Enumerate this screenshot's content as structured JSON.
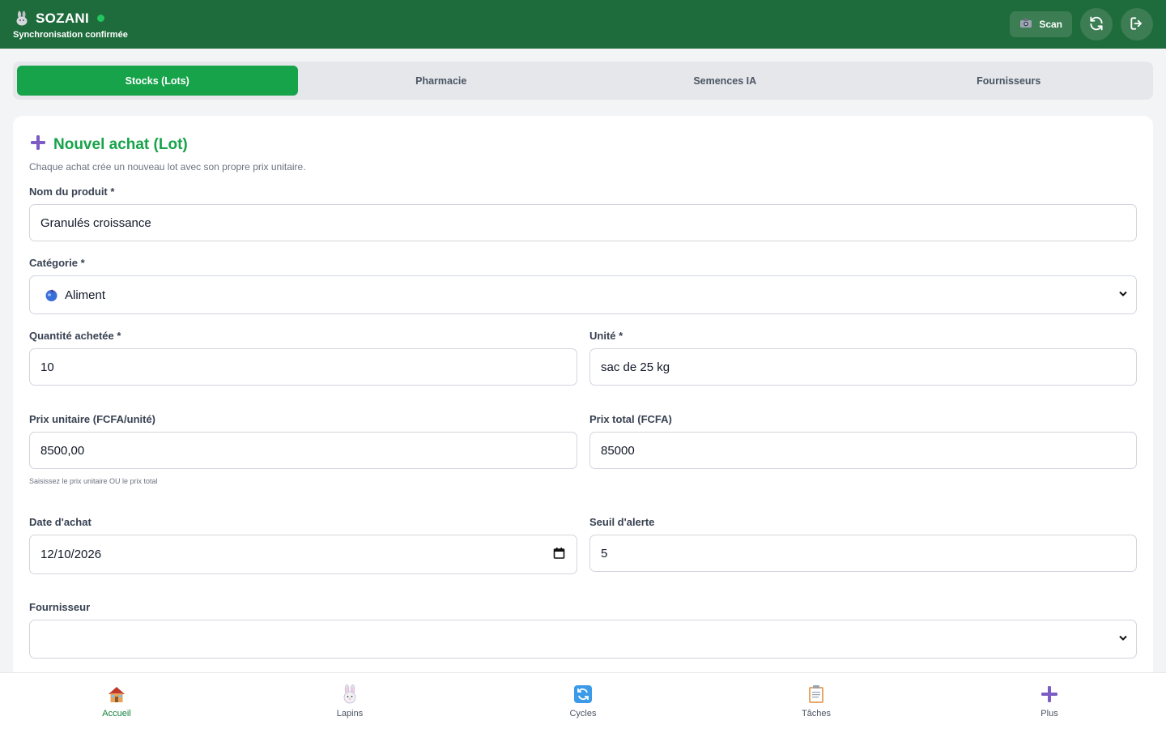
{
  "header": {
    "brand": "SOZANI",
    "sync_status": "Synchronisation confirmée",
    "scan_label": "Scan"
  },
  "tabs": [
    {
      "label": "Stocks (Lots)",
      "active": true
    },
    {
      "label": "Pharmacie",
      "active": false
    },
    {
      "label": "Semences IA",
      "active": false
    },
    {
      "label": "Fournisseurs",
      "active": false
    }
  ],
  "form": {
    "title": "Nouvel achat (Lot)",
    "subtitle": "Chaque achat crée un nouveau lot avec son propre prix unitaire.",
    "product_label": "Nom du produit *",
    "product_value": "Granulés croissance",
    "category_label": "Catégorie *",
    "category_value": "Aliment",
    "quantity_label": "Quantité achetée *",
    "quantity_value": "10",
    "unit_label": "Unité *",
    "unit_value": "sac de 25 kg",
    "unit_price_label": "Prix unitaire (FCFA/unité)",
    "unit_price_value": "8500,00",
    "total_price_label": "Prix total (FCFA)",
    "total_price_value": "85000",
    "price_hint": "Saisissez le prix unitaire OU le prix total",
    "date_label": "Date d'achat",
    "date_value": "12/10/2026",
    "threshold_label": "Seuil d'alerte",
    "threshold_value": "5",
    "supplier_label": "Fournisseur",
    "supplier_value": ""
  },
  "bottom_nav": [
    {
      "label": "Accueil",
      "icon": "house-icon",
      "active": true
    },
    {
      "label": "Lapins",
      "icon": "rabbit-icon",
      "active": false
    },
    {
      "label": "Cycles",
      "icon": "cycle-icon",
      "active": false
    },
    {
      "label": "Tâches",
      "icon": "clipboard-icon",
      "active": false
    },
    {
      "label": "Plus",
      "icon": "plus-icon",
      "active": false
    }
  ],
  "colors": {
    "header_bg": "#1e6b3c",
    "accent_green": "#16a34a",
    "status_green": "#22c55e",
    "plus_purple": "#7c3aed"
  }
}
